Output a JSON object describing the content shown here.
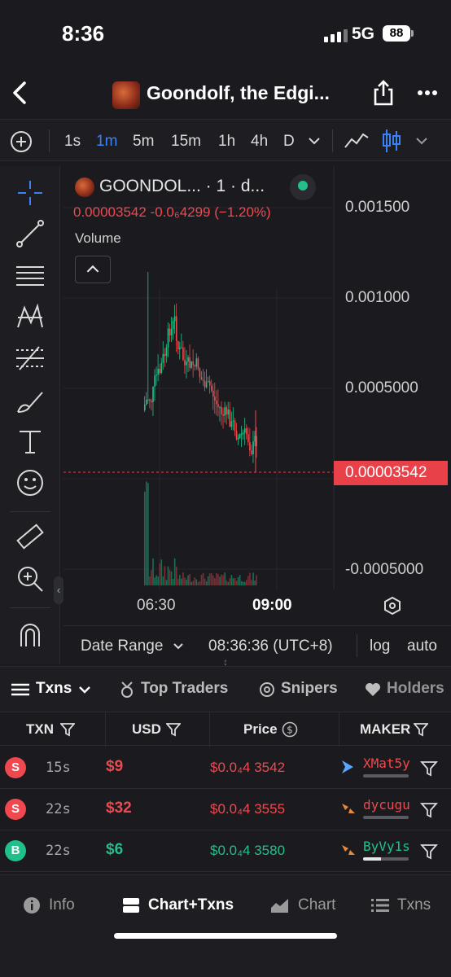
{
  "status": {
    "time": "8:36",
    "network": "5G",
    "battery": "88"
  },
  "header": {
    "title": "Goondolf, the Edgi..."
  },
  "toolbar": {
    "intervals": [
      "1s",
      "1m",
      "5m",
      "15m",
      "1h",
      "4h",
      "D"
    ],
    "active_interval": "1m"
  },
  "legend": {
    "name": "GOONDOL... · 1 · d...",
    "price_line": "0.00003542  -0.0₆4299 (−1.20%)",
    "volume": "Volume"
  },
  "axis": {
    "y_ticks": [
      "0.001500",
      "0.001000",
      "0.0005000",
      "-0.0005000"
    ],
    "current_price": "0.00003542",
    "x_ticks": [
      "06:30",
      "09:00"
    ]
  },
  "range_row": {
    "date_range": "Date Range",
    "clock": "08:36:36 (UTC+8)",
    "log": "log",
    "auto": "auto"
  },
  "tabs": {
    "txns": "Txns",
    "top_traders": "Top Traders",
    "snipers": "Snipers",
    "holders": "Holders"
  },
  "table": {
    "headers": {
      "txn": "TXN",
      "usd": "USD",
      "price": "Price",
      "maker": "MAKER"
    },
    "rows": [
      {
        "side": "S",
        "age": "15s",
        "usd": "$9",
        "price": "$0.0₄4 3542",
        "maker": "XMat5y",
        "maker_fill": 0.0
      },
      {
        "side": "S",
        "age": "22s",
        "usd": "$32",
        "price": "$0.0₄4 3555",
        "maker": "dycugu",
        "maker_fill": 0.0
      },
      {
        "side": "B",
        "age": "22s",
        "usd": "$6",
        "price": "$0.0₄4 3580",
        "maker": "ByVy1s",
        "maker_fill": 0.4
      }
    ]
  },
  "bottom_nav": {
    "info": "Info",
    "chart_txns": "Chart+Txns",
    "chart": "Chart",
    "txns": "Txns"
  },
  "colors": {
    "accent": "#3b82f6",
    "sell": "#f0484f",
    "buy": "#21c08b",
    "bg": "#1b1b1f"
  }
}
